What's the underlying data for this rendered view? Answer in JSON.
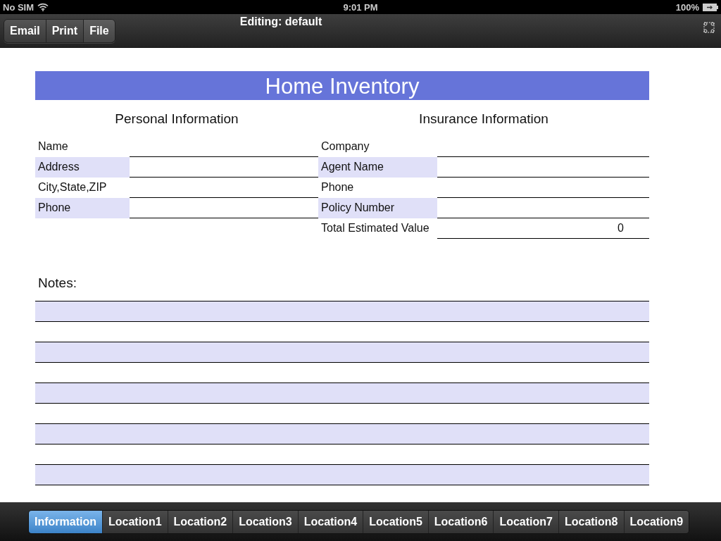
{
  "status_bar": {
    "carrier": "No SIM",
    "time": "9:01 PM",
    "battery": "100%"
  },
  "toolbar": {
    "buttons": [
      "Email",
      "Print",
      "File"
    ],
    "title": "Editing: default"
  },
  "form": {
    "title": "Home Inventory",
    "personal": {
      "heading": "Personal Information",
      "fields": [
        {
          "label": "Name"
        },
        {
          "label": "Address"
        },
        {
          "label": "City,State,ZIP"
        },
        {
          "label": "Phone"
        }
      ]
    },
    "insurance": {
      "heading": "Insurance Information",
      "fields": [
        {
          "label": "Company"
        },
        {
          "label": "Agent Name"
        },
        {
          "label": "Phone"
        },
        {
          "label": "Policy Number"
        },
        {
          "label": "Total Estimated Value",
          "value": "0"
        }
      ]
    },
    "notes": {
      "label": "Notes:"
    }
  },
  "tabs": [
    {
      "label": "Information",
      "selected": true
    },
    {
      "label": "Location1",
      "selected": false
    },
    {
      "label": "Location2",
      "selected": false
    },
    {
      "label": "Location3",
      "selected": false
    },
    {
      "label": "Location4",
      "selected": false
    },
    {
      "label": "Location5",
      "selected": false
    },
    {
      "label": "Location6",
      "selected": false
    },
    {
      "label": "Location7",
      "selected": false
    },
    {
      "label": "Location8",
      "selected": false
    },
    {
      "label": "Location9",
      "selected": false
    }
  ]
}
